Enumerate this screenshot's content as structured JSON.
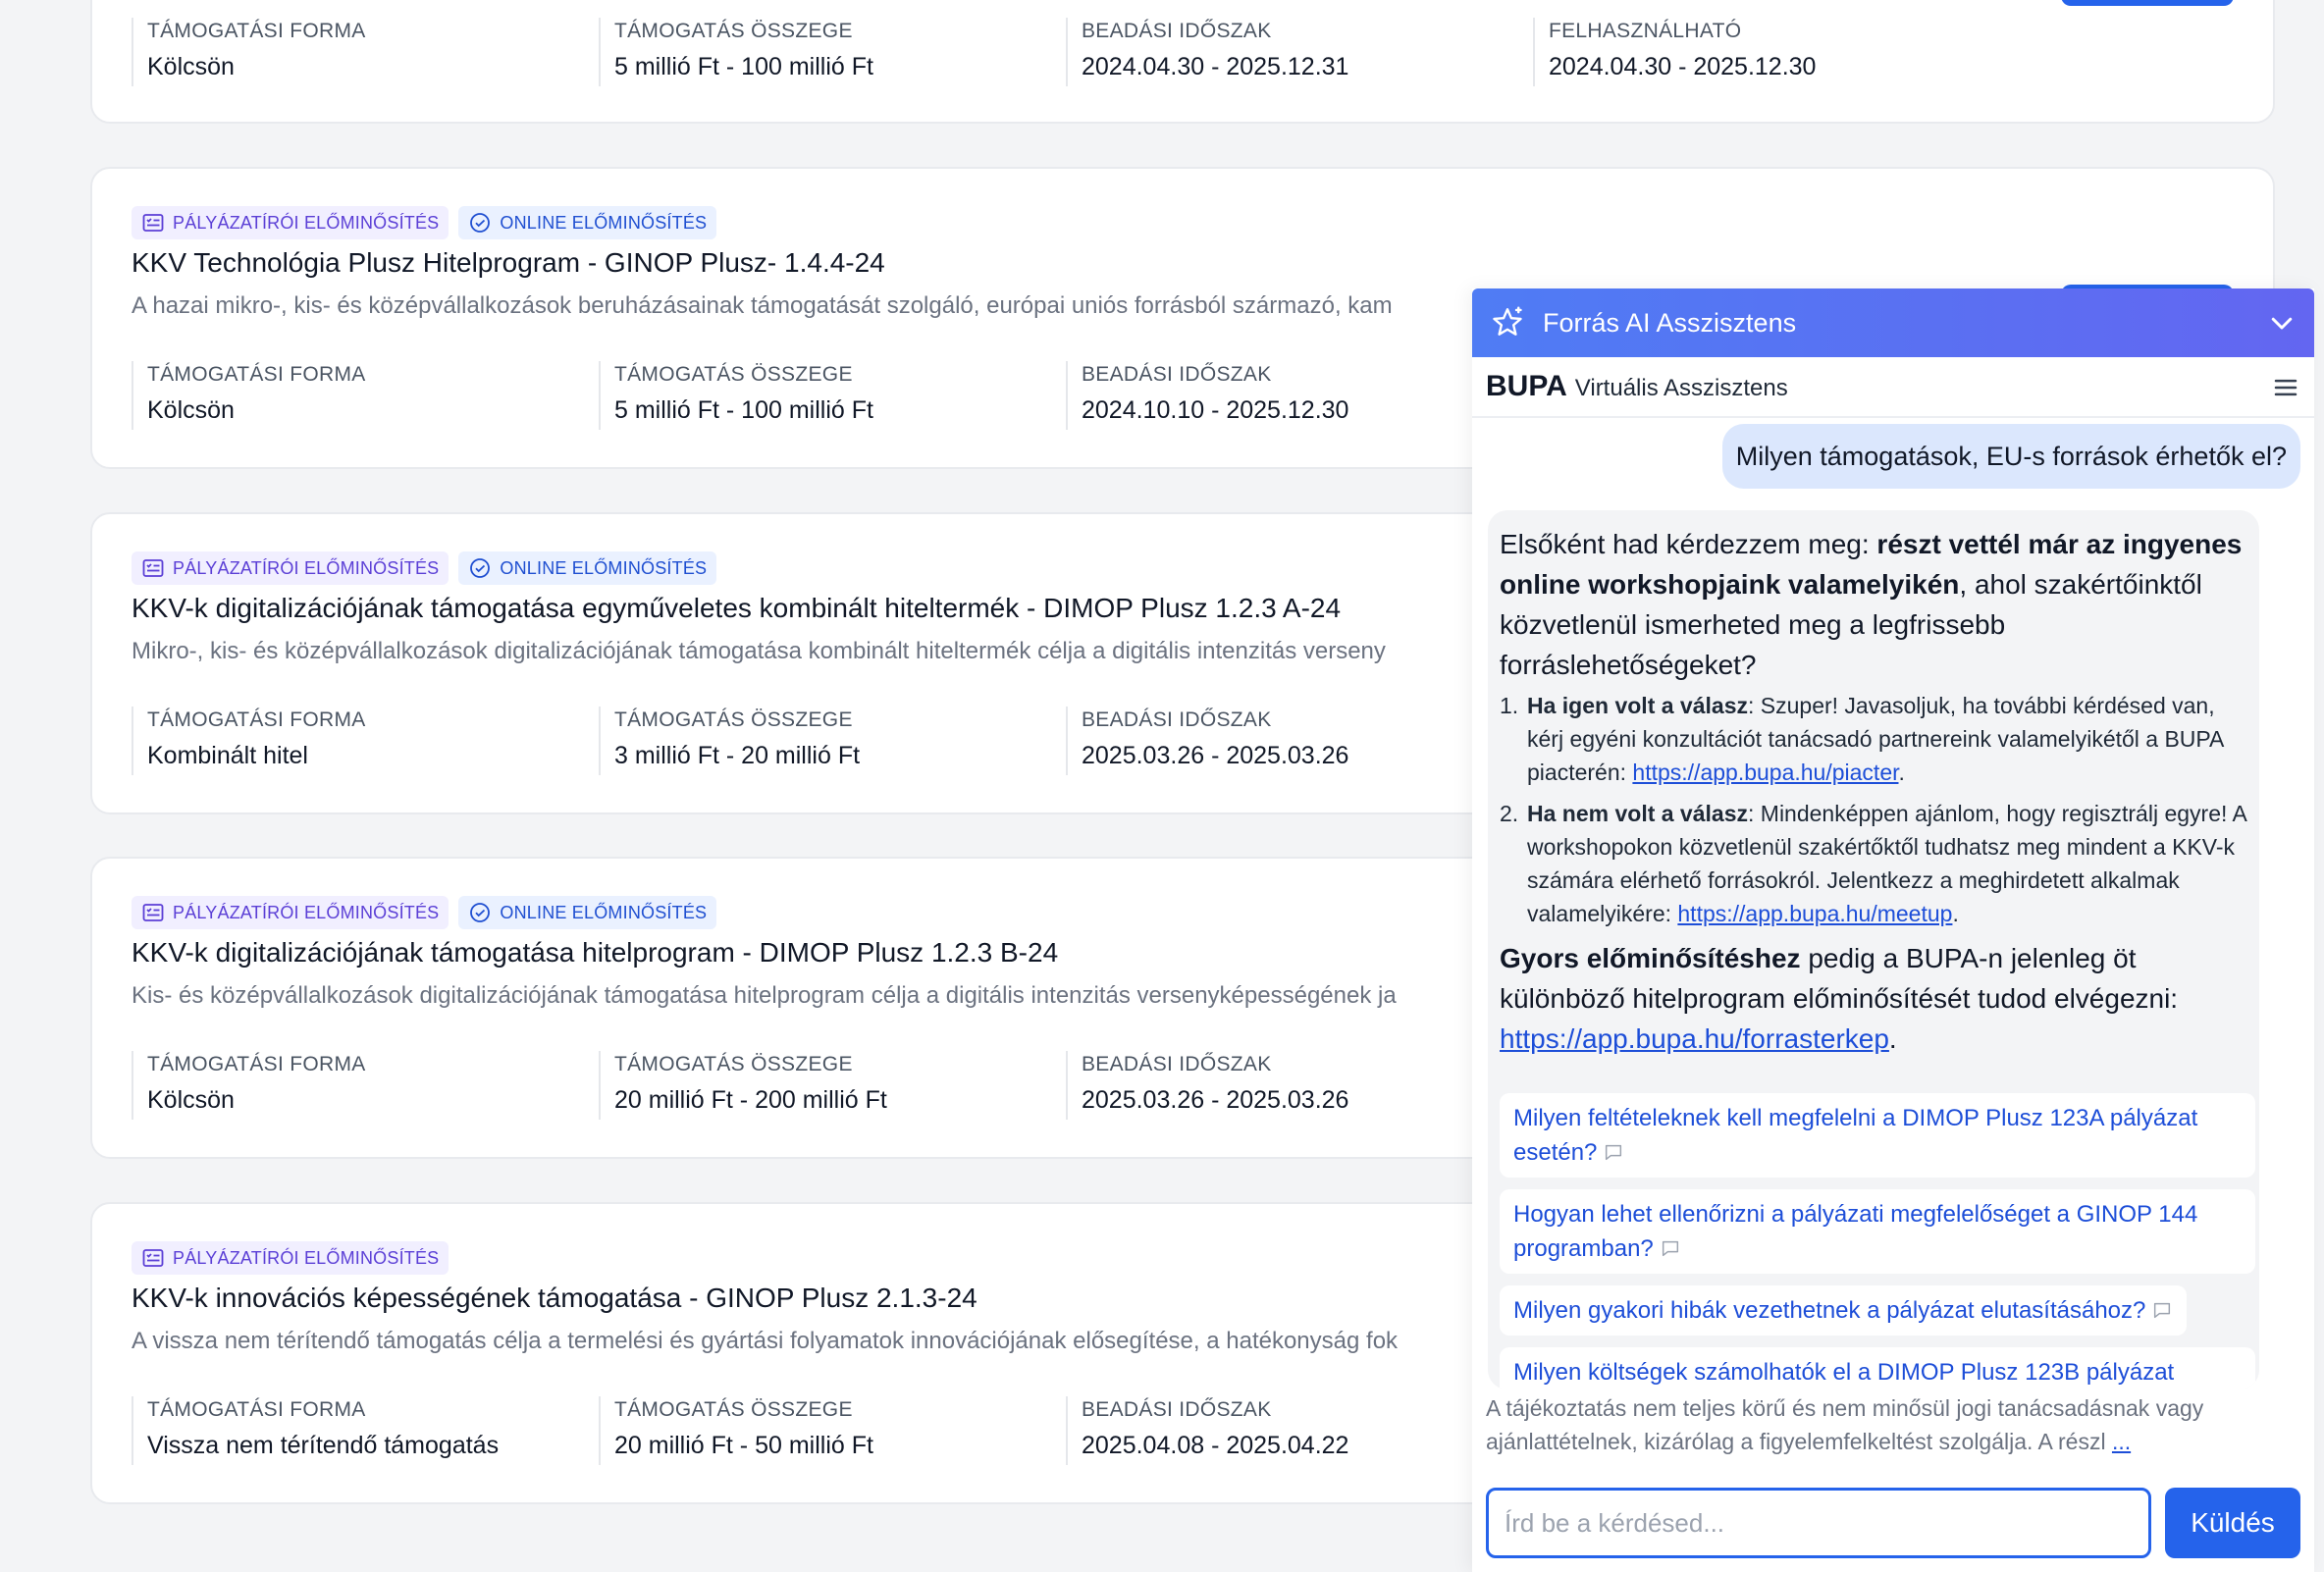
{
  "labels": {
    "form": "TÁMOGATÁSI FORMA",
    "amount": "TÁMOGATÁS ÖSSZEGE",
    "period": "BEADÁSI IDŐSZAK",
    "usable": "FELHASZNÁLHATÓ"
  },
  "badges": {
    "applicant": "PÁLYÁZATÍRÓI ELŐMINŐSÍTÉS",
    "online": "ONLINE ELŐMINŐSÍTÉS"
  },
  "cards": [
    {
      "form": "Kölcsön",
      "amount": "5 millió Ft - 100 millió Ft",
      "period": "2024.04.30 - 2025.12.31",
      "usable": "2024.04.30 - 2025.12.30"
    },
    {
      "title": "KKV Technológia Plusz Hitelprogram - GINOP Plusz- 1.4.4-24",
      "desc": "A hazai mikro-, kis- és középvállalkozások beruházásainak támogatását szolgáló, európai uniós forrásból származó, kam",
      "form": "Kölcsön",
      "amount": "5 millió Ft - 100 millió Ft",
      "period": "2024.10.10 - 2025.12.30"
    },
    {
      "title": "KKV-k digitalizációjának támogatása egyműveletes kombinált hiteltermék - DIMOP Plusz 1.2.3 A-24",
      "desc": "Mikro-, kis- és középvállalkozások digitalizációjának támogatása kombinált hiteltermék célja a digitális intenzitás verseny",
      "form": "Kombinált hitel",
      "amount": "3 millió Ft - 20 millió Ft",
      "period": "2025.03.26 - 2025.03.26"
    },
    {
      "title": "KKV-k digitalizációjának támogatása hitelprogram - DIMOP Plusz 1.2.3 B-24",
      "desc": "Kis- és középvállalkozások digitalizációjának támogatása hitelprogram célja a digitális intenzitás versenyképességének ja",
      "form": "Kölcsön",
      "amount": "20 millió Ft - 200 millió Ft",
      "period": "2025.03.26 - 2025.03.26"
    },
    {
      "title": "KKV-k innovációs képességének támogatása - GINOP Plusz 2.1.3-24",
      "desc": "A vissza nem térítendő támogatás célja a termelési és gyártási folyamatok innovációjának elősegítése, a hatékonyság fok",
      "form": "Vissza nem térítendő támogatás",
      "amount": "20 millió Ft - 50 millió Ft",
      "period": "2025.04.08 - 2025.04.22"
    }
  ],
  "chat": {
    "title": "Forrás AI Asszisztens",
    "brand": "BUPA",
    "brand_sub": "Virtuális Asszisztens",
    "user_msg": "Milyen támogatások, EU-s források érhetők el?",
    "bot": {
      "p1_a": "Elsőként had kérdezzem meg: ",
      "p1_b": "részt vettél már az ingyenes online workshopjaink valamelyikén",
      "p1_c": ", ahol szakértőinktől közvetlenül ismerheted meg a legfrissebb forráslehetőségeket?",
      "li1_num": "1.",
      "li1_b": "Ha igen volt a válasz",
      "li1_t": ": Szuper! Javasoljuk, ha további kérdésed van, kérj egyéni konzultációt tanácsadó partnereink valamelyikétől a BUPA piacterén: ",
      "li1_link": "https://app.bupa.hu/piacter",
      "li2_num": "2.",
      "li2_b": "Ha nem volt a válasz",
      "li2_t": ": Mindenképpen ajánlom, hogy regisztrálj egyre! A workshopokon közvetlenül szakértőktől tudhatsz meg mindent a KKV-k számára elérhető forrásokról. Jelentkezz a meghirdetett alkalmak valamelyikére: ",
      "li2_link": "https://app.bupa.hu/meetup",
      "p2_b": "Gyors előminősítéshez",
      "p2_t": " pedig a BUPA-n jelenleg öt különböző hitelprogram előminősítését tudod elvégezni: ",
      "p2_link": "https://app.bupa.hu/forrasterkep",
      "dot": "."
    },
    "suggestions": [
      "Milyen feltételeknek kell megfelelni a DIMOP Plusz 123A pályázat esetén?",
      "Hogyan lehet ellenőrizni a pályázati megfelelőséget a GINOP 144 programban?",
      "Milyen gyakori hibák vezethetnek a pályázat elutasításához?",
      "Milyen költségek számolhatók el a DIMOP Plusz 123B pályázat"
    ],
    "disclaimer": "A tájékoztatás nem teljes körű és nem minősül jogi tanácsadásnak vagy ajánlattételnek, kizárólag a figyelemfelkeltést szolgálja. A részl ",
    "disclaimer_more": "...",
    "input_placeholder": "Írd be a kérdésed...",
    "send_label": "Küldés"
  },
  "colors": {
    "primary": "#2563eb",
    "badge_purple": "#5b3fd6",
    "badge_blue": "#1f4fd1"
  }
}
